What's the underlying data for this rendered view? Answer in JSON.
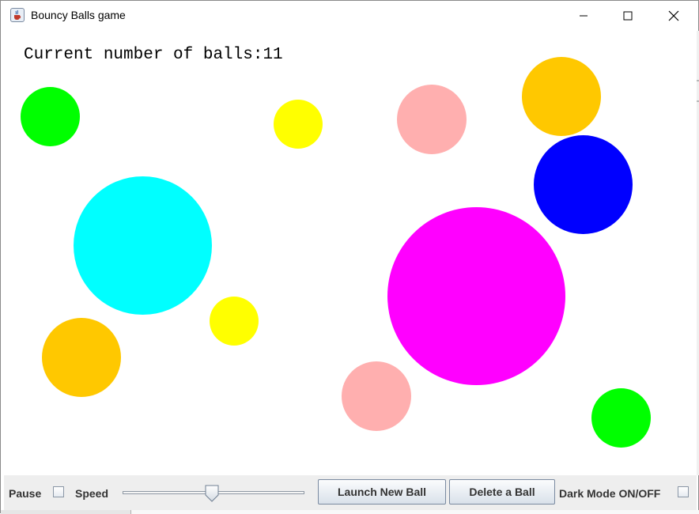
{
  "window": {
    "title": "Bouncy Balls game",
    "icon": "java-cup-icon",
    "buttons": [
      "minimize-icon",
      "maximize-icon",
      "close-icon"
    ]
  },
  "canvas": {
    "ball_count_text": "Current number of balls:11",
    "balls": [
      {
        "color": "#00ff00"
      },
      {
        "color": "#ffff00"
      },
      {
        "color": "#ffafaf"
      },
      {
        "color": "#ffc800"
      },
      {
        "color": "#0000ff"
      },
      {
        "color": "#00ffff"
      },
      {
        "color": "#ff00ff"
      },
      {
        "color": "#ffff00"
      },
      {
        "color": "#ffc800"
      },
      {
        "color": "#ffafaf"
      },
      {
        "color": "#00ff00"
      }
    ]
  },
  "controls": {
    "pause_label": "Pause",
    "pause_checked": false,
    "speed_label": "Speed",
    "speed_value_percent": 49,
    "launch_button": "Launch New Ball",
    "delete_button": "Delete a Ball",
    "dark_mode_label": "Dark Mode ON/OFF",
    "dark_mode_checked": false
  }
}
